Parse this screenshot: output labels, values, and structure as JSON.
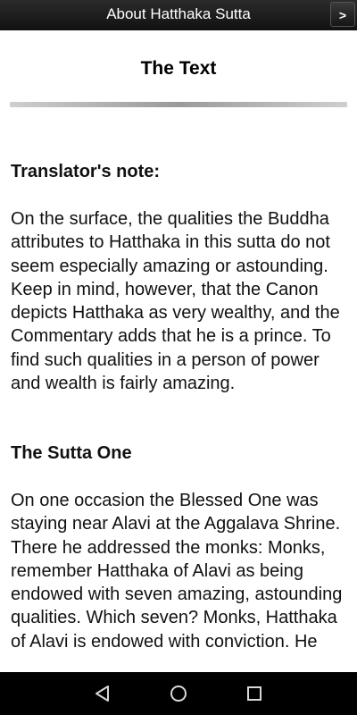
{
  "title_bar": {
    "title": "About Hatthaka Sutta",
    "next_label": ">"
  },
  "content": {
    "heading": "The Text",
    "translator_note_heading": "Translator's note:",
    "translator_note_text": "On the surface, the qualities the Buddha attributes to Hatthaka in this sutta do not seem especially amazing or astounding. Keep in mind, however, that the Canon depicts Hatthaka as very wealthy, and the Commentary adds that he is a prince. To find such qualities in a person of power and wealth is fairly amazing.",
    "sutta_heading": "The Sutta One",
    "sutta_text": "On one occasion the Blessed One was staying near Alavi at the Aggalava Shrine. There he addressed the monks: Monks, remember Hatthaka of Alavi as being endowed with seven amazing, astounding qualities. Which seven? Monks, Hatthaka of Alavi is endowed with conviction. He"
  },
  "nav_bar": {
    "back_icon": "back-triangle-icon",
    "home_icon": "home-circle-icon",
    "recents_icon": "recents-square-icon"
  }
}
